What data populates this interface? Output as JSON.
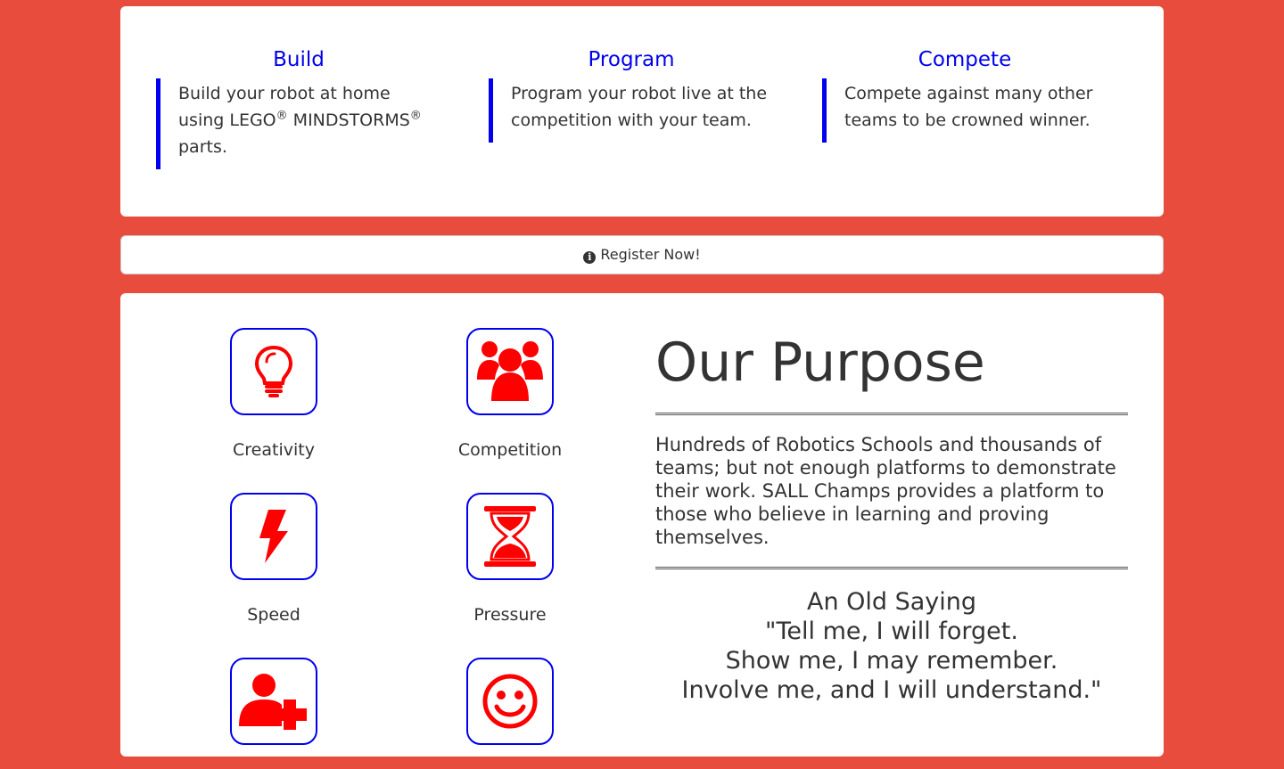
{
  "features": [
    {
      "title": "Build",
      "desc_parts": [
        "Build your robot at home using LEGO",
        "®",
        " MINDSTORMS",
        "®",
        " parts."
      ]
    },
    {
      "title": "Program",
      "desc": "Program your robot live at the competition with your team."
    },
    {
      "title": "Compete",
      "desc": "Compete against many other teams to be crowned winner."
    }
  ],
  "register": {
    "label": "Register Now!",
    "icon": "info-circle-icon"
  },
  "tiles": [
    {
      "label": "Creativity",
      "icon": "lightbulb-icon"
    },
    {
      "label": "Competition",
      "icon": "users-icon"
    },
    {
      "label": "Speed",
      "icon": "bolt-icon"
    },
    {
      "label": "Pressure",
      "icon": "hourglass-icon"
    },
    {
      "label": "",
      "icon": "user-plus-icon"
    },
    {
      "label": "",
      "icon": "smile-icon"
    }
  ],
  "purpose": {
    "heading": "Our Purpose",
    "body": "Hundreds of Robotics Schools and thousands of teams; but not enough platforms to demonstrate their work. SALL Champs provides a platform to those who believe in learning and proving themselves.",
    "saying_lines": [
      "An Old Saying",
      "\"Tell me, I will forget.",
      "Show me, I may remember.",
      "Involve me, and I will understand.\""
    ]
  },
  "colors": {
    "background": "#e74c3c",
    "accent": "#0000ee",
    "icon": "#ff0000"
  }
}
